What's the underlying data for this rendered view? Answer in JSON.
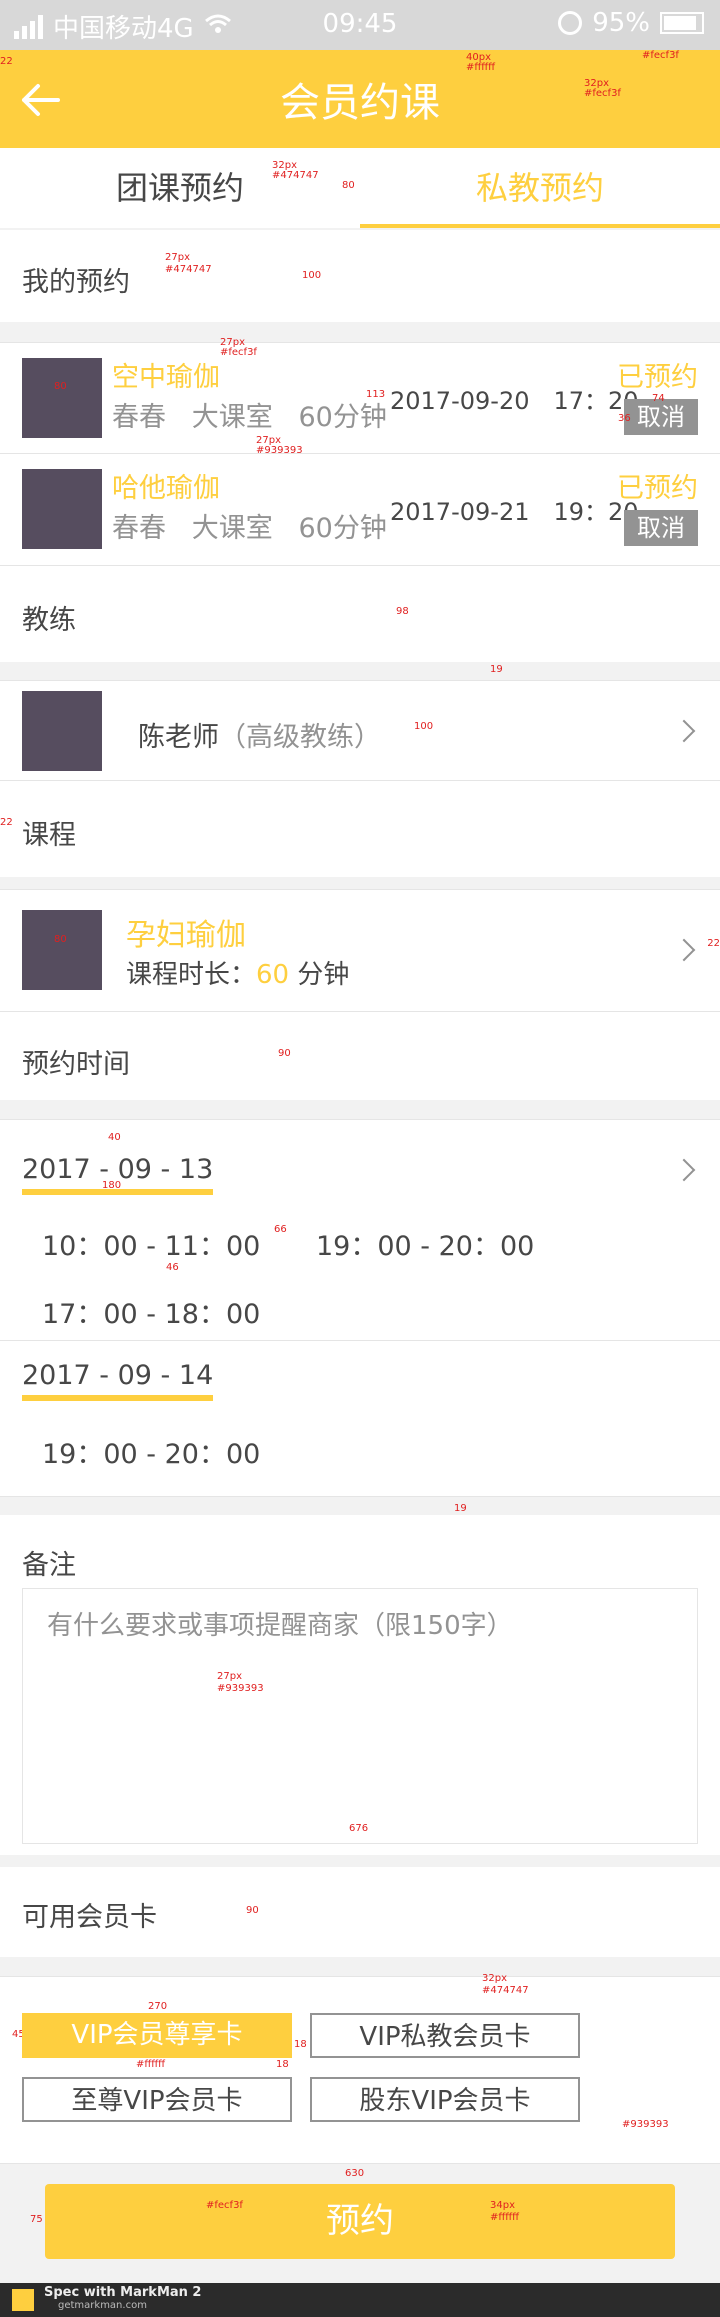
{
  "status_bar": {
    "carrier": "中国移动4G",
    "time": "09:45",
    "battery": "95%"
  },
  "header": {
    "title": "会员约课"
  },
  "tabs": [
    {
      "label": "团课预约",
      "active": false
    },
    {
      "label": "私教预约",
      "active": true
    }
  ],
  "my_bookings": {
    "title": "我的预约",
    "items": [
      {
        "name": "空中瑜伽",
        "coach": "春春",
        "room": "大课室",
        "duration": "60分钟",
        "datetime": "2017-09-20　17：20",
        "status": "已预约",
        "cancel": "取消"
      },
      {
        "name": "哈他瑜伽",
        "coach": "春春",
        "room": "大课室",
        "duration": "60分钟",
        "datetime": "2017-09-21　19：20",
        "status": "已预约",
        "cancel": "取消"
      }
    ]
  },
  "coach": {
    "title": "教练",
    "name": "陈老师",
    "level": "（高级教练）"
  },
  "course": {
    "title": "课程",
    "name": "孕妇瑜伽",
    "duration_label": "课程时长：",
    "duration_value": "60",
    "duration_unit": "分钟"
  },
  "schedule": {
    "title": "预约时间",
    "dates": [
      {
        "date": "2017 - 09 - 13",
        "slots": [
          "10：00 - 11：00",
          "19：00 - 20：00",
          "17：00 - 18：00"
        ]
      },
      {
        "date": "2017 - 09 - 14",
        "slots": [
          "19：00 - 20：00"
        ]
      }
    ]
  },
  "notes": {
    "title": "备注",
    "placeholder": "有什么要求或事项提醒商家（限150字）"
  },
  "membership_cards": {
    "title": "可用会员卡",
    "cards": [
      {
        "label": "VIP会员尊享卡",
        "selected": true
      },
      {
        "label": "VIP私教会员卡",
        "selected": false
      },
      {
        "label": "至尊VIP会员卡",
        "selected": false
      },
      {
        "label": "股东VIP会员卡",
        "selected": false
      }
    ]
  },
  "submit": {
    "label": "预约"
  },
  "footer": {
    "brand": "Spec with MarkMan 2",
    "site": "getmarkman.com"
  },
  "annotations": {
    "a1": "40px",
    "a2": "#ffffff",
    "a3": "#fecf3f",
    "a4": "32px",
    "a5": "#fecf3f",
    "a6": "32px",
    "a7": "#474747",
    "a8": "80",
    "a9": "27px",
    "a10": "#474747",
    "a11": "100",
    "a12": "27px",
    "a13": "#fecf3f",
    "a14": "80",
    "a15": "113",
    "a16": "36",
    "a17": "74",
    "a18": "27px",
    "a19": "#939393",
    "a20": "98",
    "a21": "19",
    "a22": "100",
    "a23": "22",
    "a24": "80",
    "a25": "22",
    "a26": "90",
    "a27": "40",
    "a28": "180",
    "a29": "66",
    "a30": "46",
    "a31": "19",
    "a32": "27px",
    "a33": "#939393",
    "a34": "676",
    "a35": "90",
    "a36": "270",
    "a37": "32px",
    "a38": "#474747",
    "a39": "45",
    "a40": "18",
    "a41": "18",
    "a42": "#ffffff",
    "a43": "#939393",
    "a44": "630",
    "a45": "75",
    "a46": "#fecf3f",
    "a47": "34px",
    "a48": "#ffffff",
    "a49": "22"
  },
  "colors": {
    "accent": "#fecf3f",
    "text": "#474747",
    "muted": "#939393",
    "white": "#ffffff"
  }
}
